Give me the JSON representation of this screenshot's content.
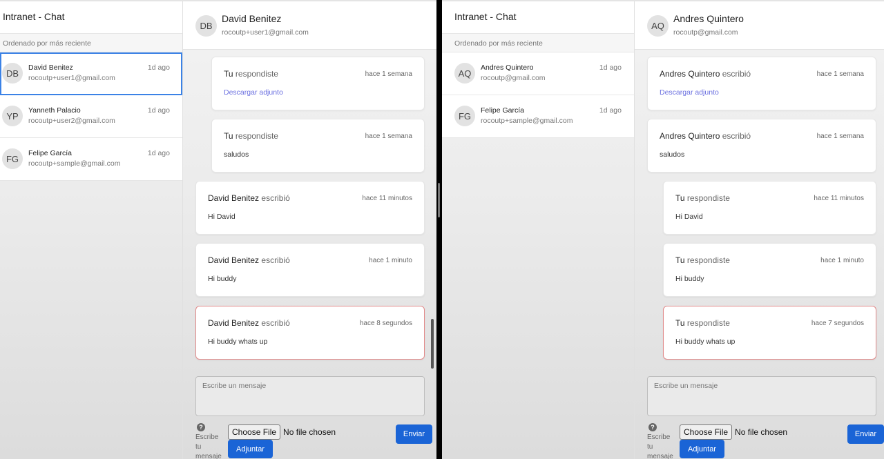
{
  "left": {
    "sidebar": {
      "title": "Intranet - Chat",
      "sort_label": "Ordenado por más reciente",
      "contacts": [
        {
          "initials": "DB",
          "name": "David Benitez",
          "email": "rocoutp+user1@gmail.com",
          "time": "1d ago"
        },
        {
          "initials": "YP",
          "name": "Yanneth Palacio",
          "email": "rocoutp+user2@gmail.com",
          "time": "1d ago"
        },
        {
          "initials": "FG",
          "name": "Felipe García",
          "email": "rocoutp+sample@gmail.com",
          "time": "1d ago"
        }
      ]
    },
    "chat": {
      "initials": "DB",
      "name": "David Benitez",
      "email": "rocoutp+user1@gmail.com",
      "messages": [
        {
          "author": "Tu",
          "verb": "respondiste",
          "time": "hace 1 semana",
          "link": "Descargar adjunto"
        },
        {
          "author": "Tu",
          "verb": "respondiste",
          "time": "hace 1 semana",
          "text": "saludos"
        },
        {
          "author": "David Benitez",
          "verb": "escribió",
          "time": "hace 11 minutos",
          "text": "Hi David"
        },
        {
          "author": "David Benitez",
          "verb": "escribió",
          "time": "hace 1 minuto",
          "text": "Hi buddy"
        },
        {
          "author": "David Benitez",
          "verb": "escribió",
          "time": "hace 8 segundos",
          "text": "Hi buddy whats up"
        }
      ],
      "composer_placeholder": "Escribe un mensaje",
      "help_text": "Escribe tu mensaje",
      "choose_file": "Choose File",
      "no_file": "No file chosen",
      "attach_label": "Adjuntar",
      "send_label": "Enviar"
    }
  },
  "right": {
    "sidebar": {
      "title": "Intranet - Chat",
      "sort_label": "Ordenado por más reciente",
      "contacts": [
        {
          "initials": "AQ",
          "name": "Andres Quintero",
          "email": "rocoutp@gmail.com",
          "time": "1d ago"
        },
        {
          "initials": "FG",
          "name": "Felipe García",
          "email": "rocoutp+sample@gmail.com",
          "time": "1d ago"
        }
      ]
    },
    "chat": {
      "initials": "AQ",
      "name": "Andres Quintero",
      "email": "rocoutp@gmail.com",
      "messages": [
        {
          "author": "Andres Quintero",
          "verb": "escribió",
          "time": "hace 1 semana",
          "link": "Descargar adjunto"
        },
        {
          "author": "Andres Quintero",
          "verb": "escribió",
          "time": "hace 1 semana",
          "text": "saludos"
        },
        {
          "author": "Tu",
          "verb": "respondiste",
          "time": "hace 11 minutos",
          "text": "Hi David"
        },
        {
          "author": "Tu",
          "verb": "respondiste",
          "time": "hace 1 minuto",
          "text": "Hi buddy"
        },
        {
          "author": "Tu",
          "verb": "respondiste",
          "time": "hace 7 segundos",
          "text": "Hi buddy whats up"
        }
      ],
      "composer_placeholder": "Escribe un mensaje",
      "help_text": "Escribe tu mensaje",
      "choose_file": "Choose File",
      "no_file": "No file chosen",
      "attach_label": "Adjuntar",
      "send_label": "Enviar"
    }
  },
  "colors": {
    "accent": "#1a64d6",
    "active_border": "#3b82e6",
    "highlight_border": "#e28a8a",
    "link": "#6a6fe0"
  }
}
